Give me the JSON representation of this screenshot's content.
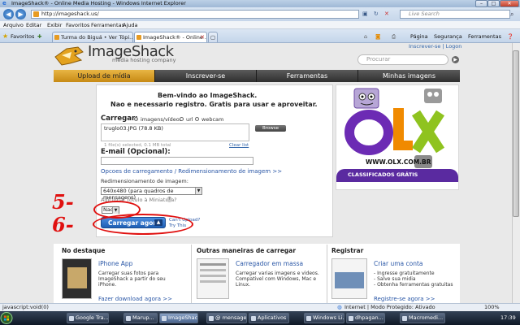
{
  "window": {
    "title": "ImageShack® - Online Media Hosting - Windows Internet Explorer",
    "controls": [
      "–",
      "□",
      "✕"
    ]
  },
  "addressbar": {
    "url": "http://imageshack.us/",
    "search_placeholder": "Live Search"
  },
  "menubar": [
    "Arquivo",
    "Editar",
    "Exibir",
    "Favoritos",
    "Ferramentas",
    "Ajuda"
  ],
  "tabs_row": {
    "favorites_label": "Favoritos",
    "tabs": [
      {
        "label": "Turma do Biguá • Ver Tópi...",
        "active": false
      },
      {
        "label": "ImageShack® - Online ...",
        "active": true
      }
    ],
    "tools": [
      "Página",
      "Segurança",
      "Ferramentas"
    ]
  },
  "site": {
    "logo_text": "ImageShack",
    "logo_sub": "media hosting company",
    "top_links": "Inscrever-se  |  Logon",
    "search_placeholder": "Procurar",
    "nav": [
      "Upload de mídia",
      "Inscrever-se",
      "Ferramentas",
      "Minhas imagens"
    ]
  },
  "upload": {
    "welcome_line1": "Bem-vindo ao ImageShack.",
    "welcome_line2": "Nao e necessario registro. Gratis para usar e aproveitar.",
    "carregar_label": "Carregar:",
    "source_options": [
      "imagens/vídeos",
      "url",
      "webcam"
    ],
    "file_name": "truglo03.JPG (78.8 KB)",
    "browse_label": "Browse",
    "file_hint": "1 file(s) selected, 0.1 MB total",
    "clear_list": "Clear list",
    "email_label": "E-mail (Opcional):",
    "options_link": "Opcoes de carregamento / Redimensionamento de imagem >>",
    "resize_label": "Redimensionamento de imagem:",
    "resize_value": "640x480 (para quadros de mensagens)",
    "thumb_label": "Adicionar rótulo à Miniatura?",
    "thumb_value": "Nao",
    "upload_button": "Carregar agora",
    "cant_upload": "Can't Upload?\nTry This"
  },
  "annotations": [
    "5-",
    "6-"
  ],
  "ad": {
    "brand": "OLX",
    "url_text": "WWW.OLX.COM.BR",
    "tagline": "CLASSIFICADOS GRÁTIS",
    "colors": {
      "o": "#6c2bb4",
      "l": "#f08a00",
      "x": "#8fc31f"
    }
  },
  "bottom": {
    "col1_title": "No destaque",
    "col2_title": "Outras maneiras de carregar",
    "col3_title": "Registrar",
    "feat1_title": "iPhone App",
    "feat1_text": "Carregar suas fotos para ImageShack a partir do seu iPhone.",
    "feat1_link": "Fazer download agora >>",
    "feat2_title": "Carregador em massa",
    "feat2_text": "Carregar varias imagens e videos. Compativel com Windows, Mac e Linux.",
    "feat3_title": "Criar uma conta",
    "feat3_items": [
      "- Ingresse gratuitamente",
      "- Salve sua midia",
      "- Obtenha ferramentas gratuitas"
    ],
    "feat3_link": "Registre-se agora >>"
  },
  "statusbar": {
    "left": "javascript:void(0)",
    "zone": "Internet | Modo Protegido: Ativado",
    "zoom": "100%"
  },
  "taskbar": {
    "items": [
      {
        "label": "Google Tra...",
        "active": false
      },
      {
        "label": "Marup...",
        "active": false
      },
      {
        "label": "ImageShac...",
        "active": true
      },
      {
        "label": "@ mensage...",
        "active": false
      },
      {
        "label": "Aplicativos",
        "active": false
      },
      {
        "label": "Windows Li...",
        "active": false
      },
      {
        "label": "dhpagan...",
        "active": false
      },
      {
        "label": "Macromedi...",
        "active": false
      }
    ],
    "clock": "17:39"
  }
}
